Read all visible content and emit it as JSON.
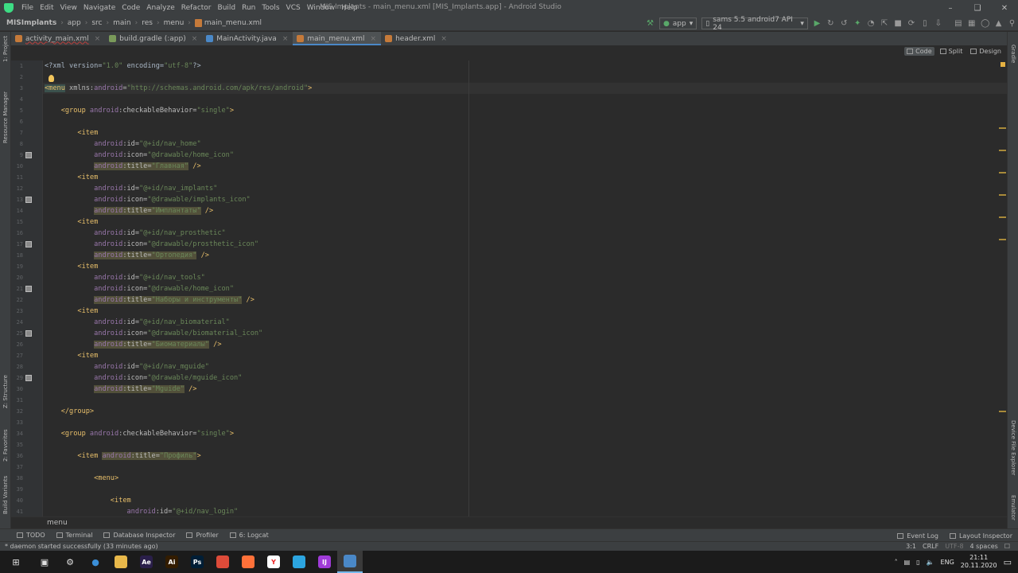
{
  "title_bar": {
    "menus": [
      "File",
      "Edit",
      "View",
      "Navigate",
      "Code",
      "Analyze",
      "Refactor",
      "Build",
      "Run",
      "Tools",
      "VCS",
      "Window",
      "Help"
    ],
    "window_title": "MIS Implants - main_menu.xml [MIS_Implants.app] - Android Studio"
  },
  "nav_bar": {
    "breadcrumbs": [
      "MISImplants",
      "app",
      "src",
      "main",
      "res",
      "menu",
      "main_menu.xml"
    ],
    "run_config": "app",
    "device": "sams 5.5 android7 API 24"
  },
  "tabs": [
    {
      "label": "activity_main.xml",
      "color": "#c57a3a",
      "active": false
    },
    {
      "label": "build.gradle (:app)",
      "color": "#7a9a5a",
      "active": false
    },
    {
      "label": "MainActivity.java",
      "color": "#4a88c7",
      "active": false
    },
    {
      "label": "main_menu.xml",
      "color": "#c57a3a",
      "active": true
    },
    {
      "label": "header.xml",
      "color": "#c57a3a",
      "active": false
    }
  ],
  "editor_modes": {
    "code": "Code",
    "split": "Split",
    "design": "Design"
  },
  "left_tool_windows": {
    "project": "1: Project",
    "resource_manager": "Resource Manager",
    "structure": "Z: Structure",
    "favorites": "2: Favorites",
    "build_variants": "Build Variants"
  },
  "right_tool_windows": {
    "gradle": "Gradle",
    "device_file_explorer": "Device File Explorer",
    "emulator": "Emulator"
  },
  "code_lines": [
    {
      "n": "1",
      "parts": [
        {
          "c": "t-txt",
          "t": "<?xml version="
        },
        {
          "c": "t-str",
          "t": "\"1.0\""
        },
        {
          "c": "t-txt",
          "t": " encoding="
        },
        {
          "c": "t-str",
          "t": "\"utf-8\""
        },
        {
          "c": "t-txt",
          "t": "?>"
        }
      ]
    },
    {
      "n": "2",
      "parts": []
    },
    {
      "n": "3",
      "parts": [
        {
          "c": "t-tag t-menu-hl",
          "t": "<menu"
        },
        {
          "c": "t-attr",
          "t": " xmlns:"
        },
        {
          "c": "t-ns",
          "t": "android"
        },
        {
          "c": "t-attr",
          "t": "="
        },
        {
          "c": "t-str",
          "t": "\"http://schemas.android.com/apk/res/android\""
        },
        {
          "c": "t-tag",
          "t": ">"
        }
      ]
    },
    {
      "n": "4",
      "parts": []
    },
    {
      "n": "5",
      "parts": [
        {
          "c": "t-txt",
          "t": "    "
        },
        {
          "c": "t-tag",
          "t": "<group "
        },
        {
          "c": "t-ns",
          "t": "android"
        },
        {
          "c": "t-attr",
          "t": ":checkableBehavior="
        },
        {
          "c": "t-str",
          "t": "\"single\""
        },
        {
          "c": "t-tag",
          "t": ">"
        }
      ]
    },
    {
      "n": "6",
      "parts": []
    },
    {
      "n": "7",
      "parts": [
        {
          "c": "t-txt",
          "t": "        "
        },
        {
          "c": "t-tag",
          "t": "<item"
        }
      ]
    },
    {
      "n": "8",
      "parts": [
        {
          "c": "t-txt",
          "t": "            "
        },
        {
          "c": "t-ns",
          "t": "android"
        },
        {
          "c": "t-attr",
          "t": ":id="
        },
        {
          "c": "t-str",
          "t": "\"@+id/nav_home\""
        }
      ]
    },
    {
      "n": "9",
      "icon": true,
      "parts": [
        {
          "c": "t-txt",
          "t": "            "
        },
        {
          "c": "t-ns",
          "t": "android"
        },
        {
          "c": "t-attr",
          "t": ":icon="
        },
        {
          "c": "t-str",
          "t": "\"@drawable/home_icon\""
        }
      ]
    },
    {
      "n": "10",
      "parts": [
        {
          "c": "t-txt",
          "t": "            "
        },
        {
          "c": "t-ns t-hl",
          "t": "android"
        },
        {
          "c": "t-attr t-hl",
          "t": ":title="
        },
        {
          "c": "t-str t-hl",
          "t": "\"Главная\""
        },
        {
          "c": "t-tag",
          "t": " />"
        }
      ]
    },
    {
      "n": "11",
      "parts": [
        {
          "c": "t-txt",
          "t": "        "
        },
        {
          "c": "t-tag",
          "t": "<item"
        }
      ]
    },
    {
      "n": "12",
      "parts": [
        {
          "c": "t-txt",
          "t": "            "
        },
        {
          "c": "t-ns",
          "t": "android"
        },
        {
          "c": "t-attr",
          "t": ":id="
        },
        {
          "c": "t-str",
          "t": "\"@+id/nav_implants\""
        }
      ]
    },
    {
      "n": "13",
      "icon": true,
      "parts": [
        {
          "c": "t-txt",
          "t": "            "
        },
        {
          "c": "t-ns",
          "t": "android"
        },
        {
          "c": "t-attr",
          "t": ":icon="
        },
        {
          "c": "t-str",
          "t": "\"@drawable/implants_icon\""
        }
      ]
    },
    {
      "n": "14",
      "parts": [
        {
          "c": "t-txt",
          "t": "            "
        },
        {
          "c": "t-ns t-hl",
          "t": "android"
        },
        {
          "c": "t-attr t-hl",
          "t": ":title="
        },
        {
          "c": "t-str t-hl",
          "t": "\"Имплантаты\""
        },
        {
          "c": "t-tag",
          "t": " />"
        }
      ]
    },
    {
      "n": "15",
      "parts": [
        {
          "c": "t-txt",
          "t": "        "
        },
        {
          "c": "t-tag",
          "t": "<item"
        }
      ]
    },
    {
      "n": "16",
      "parts": [
        {
          "c": "t-txt",
          "t": "            "
        },
        {
          "c": "t-ns",
          "t": "android"
        },
        {
          "c": "t-attr",
          "t": ":id="
        },
        {
          "c": "t-str",
          "t": "\"@+id/nav_prosthetic\""
        }
      ]
    },
    {
      "n": "17",
      "icon": true,
      "parts": [
        {
          "c": "t-txt",
          "t": "            "
        },
        {
          "c": "t-ns",
          "t": "android"
        },
        {
          "c": "t-attr",
          "t": ":icon="
        },
        {
          "c": "t-str",
          "t": "\"@drawable/prosthetic_icon\""
        }
      ]
    },
    {
      "n": "18",
      "parts": [
        {
          "c": "t-txt",
          "t": "            "
        },
        {
          "c": "t-ns t-hl",
          "t": "android"
        },
        {
          "c": "t-attr t-hl",
          "t": ":title="
        },
        {
          "c": "t-str t-hl",
          "t": "\"Ортопедия\""
        },
        {
          "c": "t-tag",
          "t": " />"
        }
      ]
    },
    {
      "n": "19",
      "parts": [
        {
          "c": "t-txt",
          "t": "        "
        },
        {
          "c": "t-tag",
          "t": "<item"
        }
      ]
    },
    {
      "n": "20",
      "parts": [
        {
          "c": "t-txt",
          "t": "            "
        },
        {
          "c": "t-ns",
          "t": "android"
        },
        {
          "c": "t-attr",
          "t": ":id="
        },
        {
          "c": "t-str",
          "t": "\"@+id/nav_tools\""
        }
      ]
    },
    {
      "n": "21",
      "icon": true,
      "parts": [
        {
          "c": "t-txt",
          "t": "            "
        },
        {
          "c": "t-ns",
          "t": "android"
        },
        {
          "c": "t-attr",
          "t": ":icon="
        },
        {
          "c": "t-str",
          "t": "\"@drawable/home_icon\""
        }
      ]
    },
    {
      "n": "22",
      "parts": [
        {
          "c": "t-txt",
          "t": "            "
        },
        {
          "c": "t-ns t-hl",
          "t": "android"
        },
        {
          "c": "t-attr t-hl",
          "t": ":title="
        },
        {
          "c": "t-str t-hl",
          "t": "\"Наборы и инструменты\""
        },
        {
          "c": "t-tag",
          "t": " />"
        }
      ]
    },
    {
      "n": "23",
      "parts": [
        {
          "c": "t-txt",
          "t": "        "
        },
        {
          "c": "t-tag",
          "t": "<item"
        }
      ]
    },
    {
      "n": "24",
      "parts": [
        {
          "c": "t-txt",
          "t": "            "
        },
        {
          "c": "t-ns",
          "t": "android"
        },
        {
          "c": "t-attr",
          "t": ":id="
        },
        {
          "c": "t-str",
          "t": "\"@+id/nav_biomaterial\""
        }
      ]
    },
    {
      "n": "25",
      "icon": true,
      "parts": [
        {
          "c": "t-txt",
          "t": "            "
        },
        {
          "c": "t-ns",
          "t": "android"
        },
        {
          "c": "t-attr",
          "t": ":icon="
        },
        {
          "c": "t-str",
          "t": "\"@drawable/biomaterial_icon\""
        }
      ]
    },
    {
      "n": "26",
      "parts": [
        {
          "c": "t-txt",
          "t": "            "
        },
        {
          "c": "t-ns t-hl",
          "t": "android"
        },
        {
          "c": "t-attr t-hl",
          "t": ":title="
        },
        {
          "c": "t-str t-hl",
          "t": "\"Биоматериалы\""
        },
        {
          "c": "t-tag",
          "t": " />"
        }
      ]
    },
    {
      "n": "27",
      "parts": [
        {
          "c": "t-txt",
          "t": "        "
        },
        {
          "c": "t-tag",
          "t": "<item"
        }
      ]
    },
    {
      "n": "28",
      "parts": [
        {
          "c": "t-txt",
          "t": "            "
        },
        {
          "c": "t-ns",
          "t": "android"
        },
        {
          "c": "t-attr",
          "t": ":id="
        },
        {
          "c": "t-str",
          "t": "\"@+id/nav_mguide\""
        }
      ]
    },
    {
      "n": "29",
      "icon": true,
      "parts": [
        {
          "c": "t-txt",
          "t": "            "
        },
        {
          "c": "t-ns",
          "t": "android"
        },
        {
          "c": "t-attr",
          "t": ":icon="
        },
        {
          "c": "t-str",
          "t": "\"@drawable/mguide_icon\""
        }
      ]
    },
    {
      "n": "30",
      "parts": [
        {
          "c": "t-txt",
          "t": "            "
        },
        {
          "c": "t-ns t-hl",
          "t": "android"
        },
        {
          "c": "t-attr t-hl",
          "t": ":title="
        },
        {
          "c": "t-str t-hl",
          "t": "\"Mguide\""
        },
        {
          "c": "t-tag",
          "t": " />"
        }
      ]
    },
    {
      "n": "31",
      "parts": []
    },
    {
      "n": "32",
      "parts": [
        {
          "c": "t-txt",
          "t": "    "
        },
        {
          "c": "t-tag",
          "t": "</group>"
        }
      ]
    },
    {
      "n": "33",
      "parts": []
    },
    {
      "n": "34",
      "parts": [
        {
          "c": "t-txt",
          "t": "    "
        },
        {
          "c": "t-tag",
          "t": "<group "
        },
        {
          "c": "t-ns",
          "t": "android"
        },
        {
          "c": "t-attr",
          "t": ":checkableBehavior="
        },
        {
          "c": "t-str",
          "t": "\"single\""
        },
        {
          "c": "t-tag",
          "t": ">"
        }
      ]
    },
    {
      "n": "35",
      "parts": []
    },
    {
      "n": "36",
      "parts": [
        {
          "c": "t-txt",
          "t": "        "
        },
        {
          "c": "t-tag",
          "t": "<item "
        },
        {
          "c": "t-ns t-hl",
          "t": "android"
        },
        {
          "c": "t-attr t-hl",
          "t": ":title="
        },
        {
          "c": "t-str t-hl",
          "t": "\"Профиль\""
        },
        {
          "c": "t-tag",
          "t": ">"
        }
      ]
    },
    {
      "n": "37",
      "parts": []
    },
    {
      "n": "38",
      "parts": [
        {
          "c": "t-txt",
          "t": "            "
        },
        {
          "c": "t-tag",
          "t": "<menu>"
        }
      ]
    },
    {
      "n": "39",
      "parts": []
    },
    {
      "n": "40",
      "parts": [
        {
          "c": "t-txt",
          "t": "                "
        },
        {
          "c": "t-tag",
          "t": "<item"
        }
      ]
    },
    {
      "n": "41",
      "parts": [
        {
          "c": "t-txt",
          "t": "                    "
        },
        {
          "c": "t-ns",
          "t": "android"
        },
        {
          "c": "t-attr",
          "t": ":id="
        },
        {
          "c": "t-str",
          "t": "\"@+id/nav_login\""
        }
      ]
    }
  ],
  "editor_breadcrumb": "menu",
  "tool_windows_bottom": [
    "TODO",
    "Terminal",
    "Database Inspector",
    "Profiler",
    "6: Logcat"
  ],
  "tool_windows_bottom_right": [
    "Event Log",
    "Layout Inspector"
  ],
  "status": {
    "message": "* daemon started successfully (33 minutes ago)",
    "position": "3:1",
    "line_sep": "CRLF",
    "encoding": "UTF-8",
    "indent": "4 spaces"
  },
  "taskbar": {
    "language": "ENG",
    "time": "21:11",
    "date": "20.11.2020",
    "apps": [
      {
        "name": "folder-app",
        "label": "",
        "bg": "#e8b84a"
      },
      {
        "name": "after-effects-app",
        "label": "Ae",
        "bg": "#2a1f4a"
      },
      {
        "name": "illustrator-app",
        "label": "Ai",
        "bg": "#331c00"
      },
      {
        "name": "photoshop-app",
        "label": "Ps",
        "bg": "#001e36"
      },
      {
        "name": "chrome-app",
        "label": "",
        "bg": "#dd4b39"
      },
      {
        "name": "firefox-app",
        "label": "",
        "bg": "#ff7139"
      },
      {
        "name": "yandex-app",
        "label": "Y",
        "bg": "#ffffff"
      },
      {
        "name": "telegram-app",
        "label": "",
        "bg": "#2ca5e0"
      },
      {
        "name": "intellij-app",
        "label": "IJ",
        "bg": "#a03bd8"
      },
      {
        "name": "android-studio-app",
        "label": "",
        "bg": "#4a88c7"
      }
    ]
  }
}
